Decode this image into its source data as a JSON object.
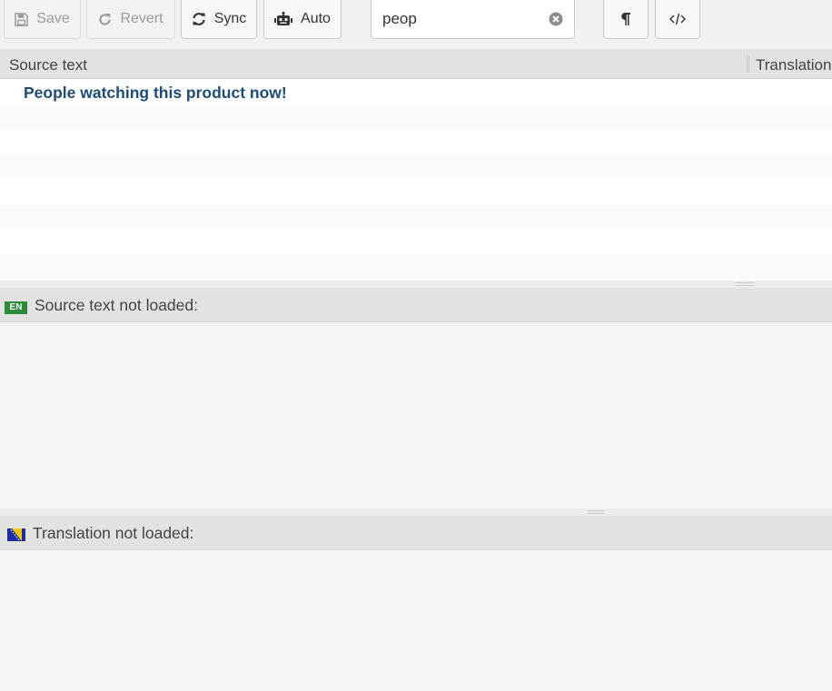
{
  "toolbar": {
    "save_label": "Save",
    "revert_label": "Revert",
    "sync_label": "Sync",
    "auto_label": "Auto",
    "save_icon": "floppy-disk-icon",
    "revert_icon": "undo-arrow-icon",
    "sync_icon": "refresh-icon",
    "auto_icon": "robot-icon",
    "pilcrow_icon": "pilcrow-icon",
    "code_icon": "code-tags-icon"
  },
  "search": {
    "value": "peop",
    "clear_icon": "clear-circle-x-icon"
  },
  "table": {
    "columns": [
      "Source text",
      "Translation"
    ],
    "rows": [
      {
        "source": "People watching this product now!",
        "translation": ""
      }
    ]
  },
  "source_panel": {
    "locale_badge": "EN",
    "label": "Source text not loaded:"
  },
  "translation_panel": {
    "flag": "bosnia-flag-icon",
    "label": "Translation not loaded:"
  },
  "colors": {
    "row_text": "#1d4c74",
    "en_badge": "#2d8a3a",
    "header_bg": "#e2e2e2"
  }
}
